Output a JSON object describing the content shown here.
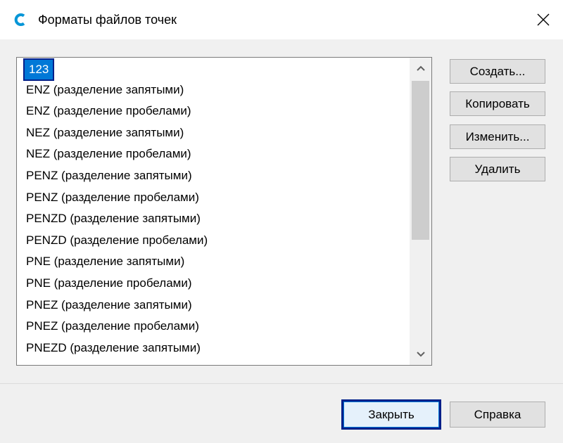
{
  "window": {
    "title": "Форматы файлов точек",
    "icon": "civil3d-app-icon",
    "close_icon": "close-icon"
  },
  "list": {
    "selected_index": 0,
    "items": [
      "123",
      "ENZ (разделение запятыми)",
      "ENZ (разделение пробелами)",
      "NEZ (разделение запятыми)",
      "NEZ (разделение пробелами)",
      "PENZ (разделение запятыми)",
      "PENZ (разделение пробелами)",
      "PENZD (разделение запятыми)",
      "PENZD (разделение пробелами)",
      "PNE (разделение запятыми)",
      "PNE (разделение пробелами)",
      "PNEZ (разделение запятыми)",
      "PNEZ (разделение пробелами)",
      "PNEZD (разделение запятыми)"
    ]
  },
  "actions": {
    "create": "Создать...",
    "copy": "Копировать",
    "edit": "Изменить...",
    "delete": "Удалить"
  },
  "footer": {
    "close": "Закрыть",
    "help": "Справка"
  },
  "colors": {
    "selection": "#0078d7",
    "focus_border": "#00208a",
    "accent_icon": "#0696d7"
  }
}
